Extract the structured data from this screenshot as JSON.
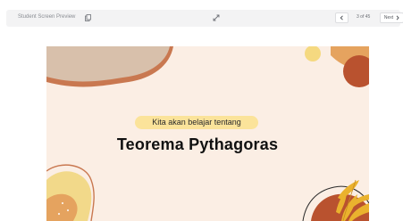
{
  "toolbar": {
    "preview_label": "Student Screen Preview",
    "page_indicator": "3 of 45",
    "next_label": "Next",
    "icons": {
      "copy": "copy-icon",
      "expand": "expand-icon",
      "prev": "chevron-left-icon",
      "next": "chevron-right-icon"
    }
  },
  "slide": {
    "subtitle": "Kita akan belajar tentang",
    "title": "Teorema Pythagoras",
    "colors": {
      "background": "#fbeee4",
      "subtitle_highlight": "#fbe39a",
      "blob_beige": "#d8c0ab",
      "blob_rust": "#b9522f",
      "blob_orange": "#e5a35f",
      "blob_yellow": "#f2d98a",
      "leaf_yellow": "#eab22e"
    }
  }
}
